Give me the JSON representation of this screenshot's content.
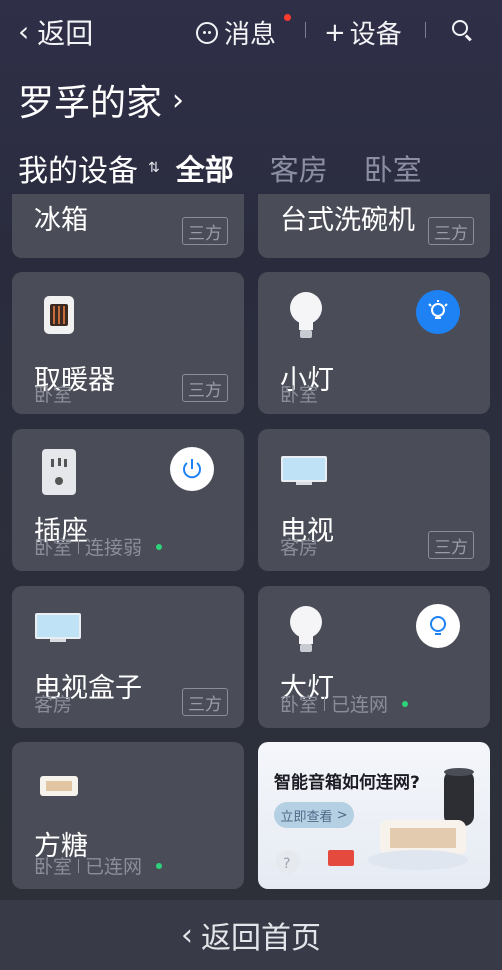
{
  "topbar": {
    "back_label": "返回",
    "messages_label": "消息",
    "add_device_label": "设备"
  },
  "home": {
    "title": "罗孚的家"
  },
  "tabs": {
    "my_devices": "我的设备",
    "items": [
      "全部",
      "客房",
      "卧室"
    ]
  },
  "devices": [
    {
      "name": "冰箱",
      "room": "",
      "badge": "三方",
      "icon": "fridge-icon"
    },
    {
      "name": "台式洗碗机",
      "room": "",
      "badge": "三方",
      "icon": "dishwasher-icon"
    },
    {
      "name": "取暖器",
      "room": "卧室",
      "badge": "三方",
      "icon": "heater-icon"
    },
    {
      "name": "小灯",
      "room": "卧室",
      "badge": "",
      "icon": "bulb-icon",
      "control": "light-toggle-on"
    },
    {
      "name": "插座",
      "room": "卧室",
      "status": "连接弱",
      "icon": "socket-icon",
      "control": "power-toggle"
    },
    {
      "name": "电视",
      "room": "客房",
      "badge": "三方",
      "icon": "tv-icon"
    },
    {
      "name": "电视盒子",
      "room": "客房",
      "badge": "三方",
      "icon": "tv-box-icon"
    },
    {
      "name": "大灯",
      "room": "卧室",
      "status": "已连网",
      "icon": "bulb-icon",
      "control": "light-toggle-off"
    },
    {
      "name": "方糖",
      "room": "卧室",
      "status": "已连网",
      "icon": "speaker-icon"
    }
  ],
  "promo": {
    "title": "智能音箱如何连网?",
    "cta": "立即查看",
    "cta_arrow": ">"
  },
  "bottom": {
    "label": "返回首页"
  },
  "colors": {
    "accent_blue": "#1e82f5",
    "status_green": "#2ed27a",
    "card_bg": "#4a4d58"
  }
}
